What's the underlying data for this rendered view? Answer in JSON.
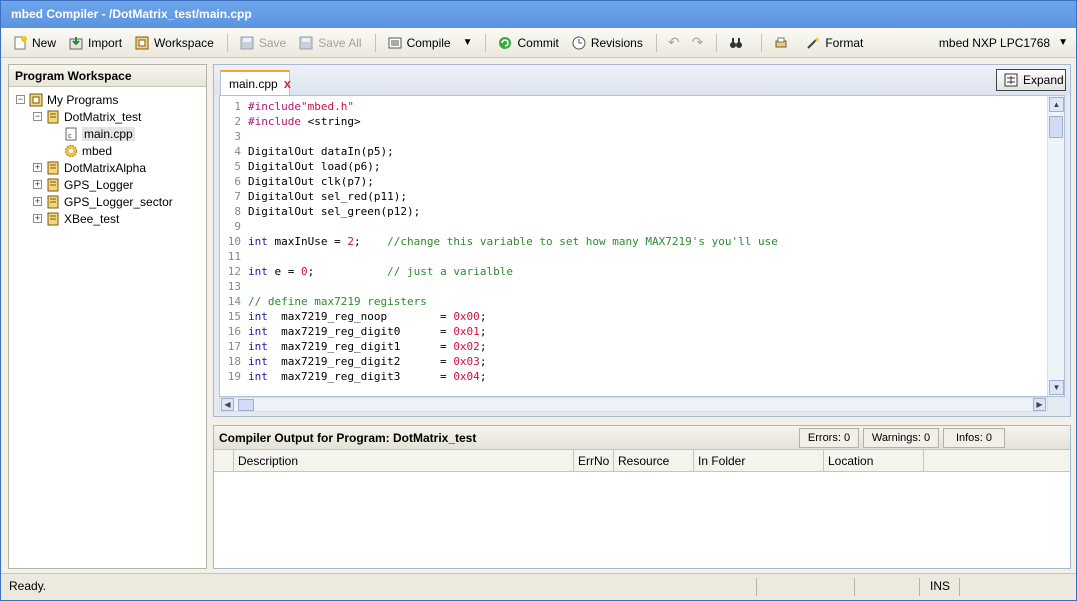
{
  "window": {
    "title": "mbed Compiler - /DotMatrix_test/main.cpp"
  },
  "toolbar": {
    "new_label": "New",
    "import_label": "Import",
    "workspace_label": "Workspace",
    "save_label": "Save",
    "save_all_label": "Save All",
    "compile_label": "Compile",
    "commit_label": "Commit",
    "revisions_label": "Revisions",
    "format_label": "Format",
    "device_label": "mbed NXP LPC1768"
  },
  "workspace": {
    "title": "Program Workspace",
    "root": "My Programs",
    "program": "DotMatrix_test",
    "file_main": "main.cpp",
    "lib_mbed": "mbed",
    "others": [
      "DotMatrixAlpha",
      "GPS_Logger",
      "GPS_Logger_sector",
      "XBee_test"
    ]
  },
  "editor": {
    "tab_label": "main.cpp",
    "tab_close": "x",
    "expand_label": "Expand",
    "line_numbers": [
      "1",
      "2",
      "3",
      "4",
      "5",
      "6",
      "7",
      "8",
      "9",
      "10",
      "11",
      "12",
      "13",
      "14",
      "15",
      "16",
      "17",
      "18",
      "19"
    ]
  },
  "output": {
    "title": "Compiler Output for Program: DotMatrix_test",
    "errors": "Errors: 0",
    "warnings": "Warnings: 0",
    "infos": "Infos: 0",
    "columns": [
      "Description",
      "ErrNo",
      "Resource",
      "In Folder",
      "Location"
    ]
  },
  "status": {
    "text": "Ready.",
    "mode": "INS"
  },
  "colors": {
    "keyword": "#1a1aa6",
    "string": "#d10f3f",
    "preprocessor": "#b0147a",
    "comment": "#2e8b2e",
    "number": "#d10f3f"
  }
}
